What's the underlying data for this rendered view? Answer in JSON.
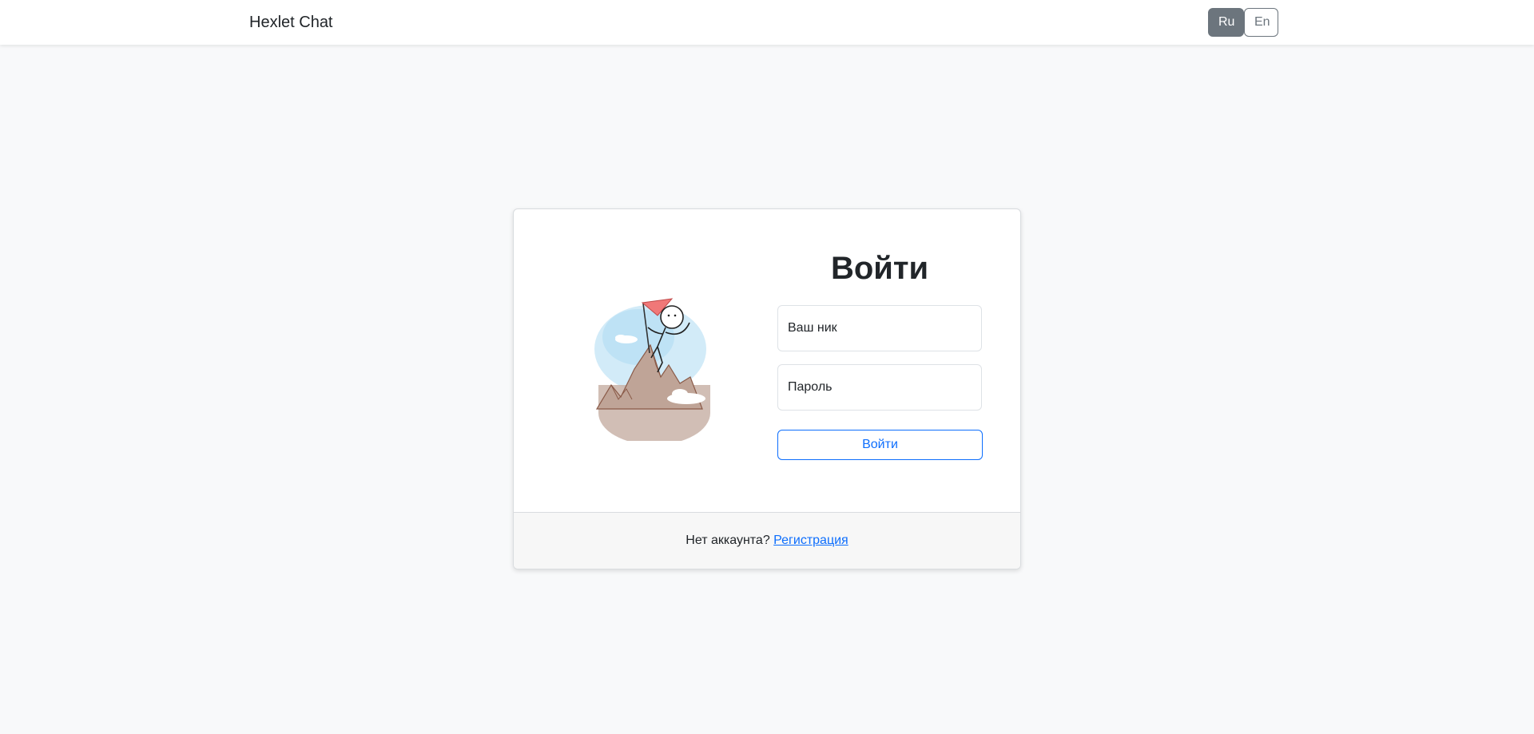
{
  "navbar": {
    "brand": "Hexlet Chat",
    "languages": [
      {
        "label": "Ru",
        "active": true
      },
      {
        "label": "En",
        "active": false
      }
    ]
  },
  "login": {
    "title": "Войти",
    "username_placeholder": "Ваш ник",
    "password_placeholder": "Пароль",
    "submit_label": "Войти",
    "illustration_icon": "mountain-climber-illustration"
  },
  "footer": {
    "prompt": "Нет аккаунта? ",
    "signup_link": "Регистрация"
  },
  "colors": {
    "background": "#f8f9fa",
    "primary": "#0d6efd",
    "secondary": "#6c757d",
    "flag": "#f07878"
  }
}
